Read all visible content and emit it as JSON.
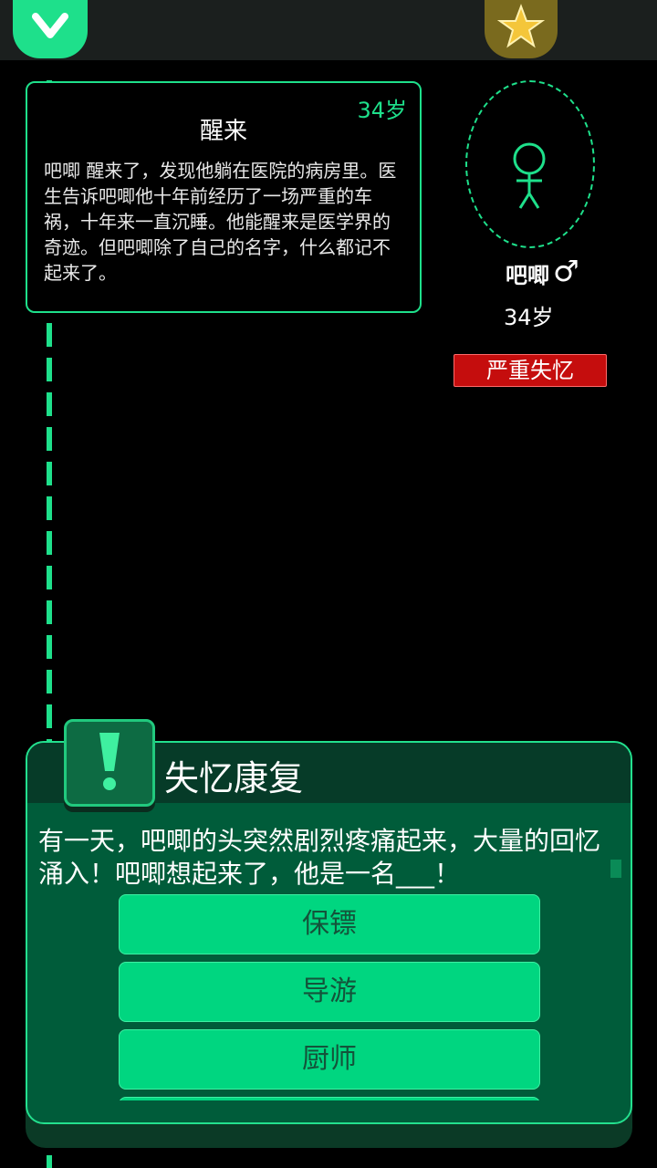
{
  "top_bar": {
    "collapse_icon": "chevron-down-icon",
    "star_icon": "star-icon"
  },
  "event": {
    "age": "34岁",
    "title": "醒来",
    "text": " 吧唧 醒来了，发现他躺在医院的病房里。医生告诉吧唧他十年前经历了一场严重的车祸，十年来一直沉睡。他能醒来是医学界的奇迹。但吧唧除了自己的名字，什么都记不起来了。"
  },
  "character": {
    "name": "吧唧",
    "gender": "♂",
    "age": "34岁",
    "status": "严重失忆",
    "status_color": "#c50d0d"
  },
  "dialog": {
    "icon": "exclamation-icon",
    "title": "失忆康复",
    "text": "有一天，吧唧的头突然剧烈疼痛起来，大量的回忆涌入！吧唧想起来了，他是一名___！",
    "options": [
      "保镖",
      "导游",
      "厨师",
      ""
    ]
  },
  "colors": {
    "accent": "#1ee08b",
    "dialog_bg": "#005c3a",
    "button": "#00d680"
  }
}
